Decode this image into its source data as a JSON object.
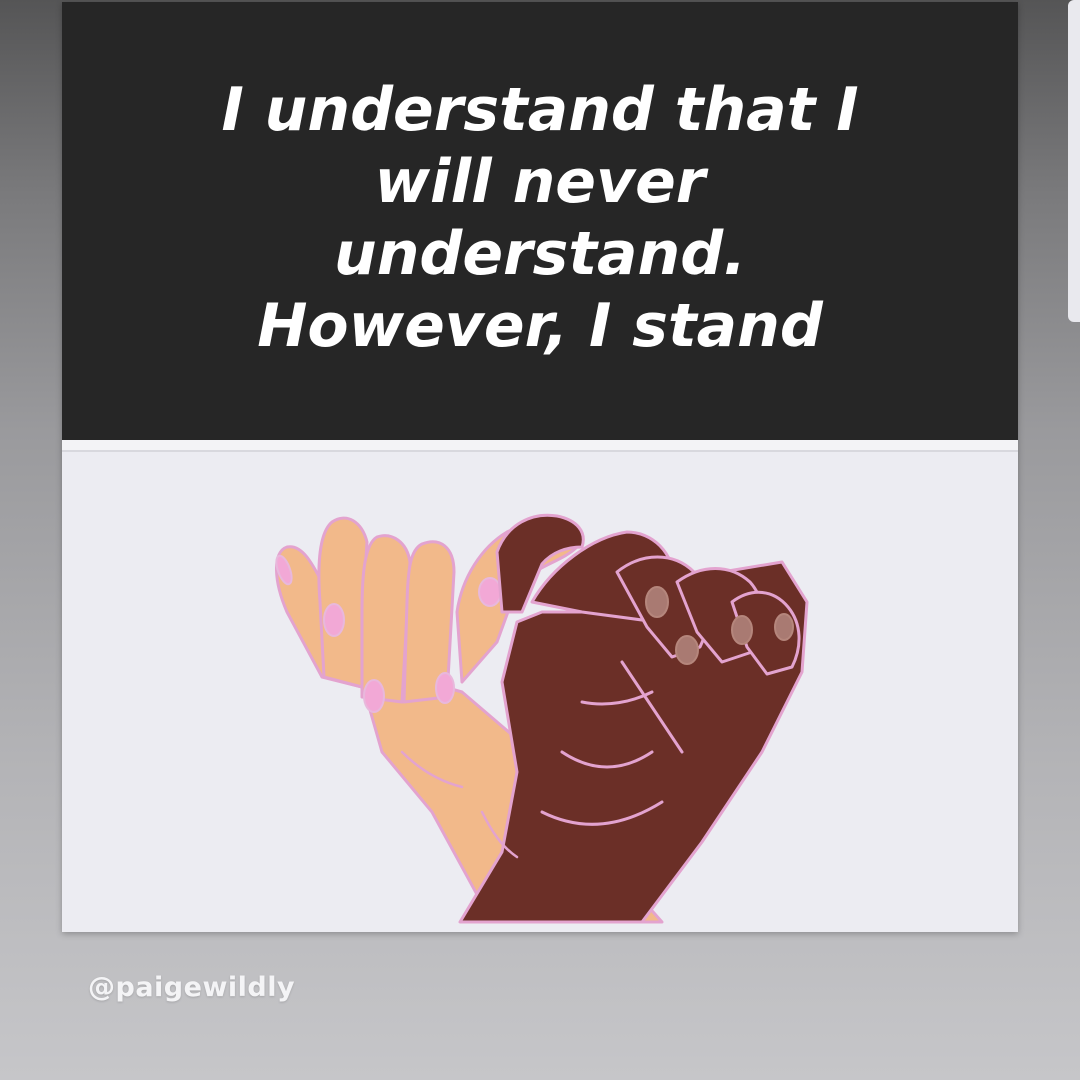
{
  "post": {
    "quote": "I understand that I\nwill never\nunderstand.\nHowever, I stand",
    "illustration_icon": "pinky-promise-hands-icon",
    "credit": "@paigewildly"
  },
  "colors": {
    "background_top": "#555556",
    "background_bottom": "#c6c6c9",
    "quote_band": "#262626",
    "quote_text": "#ffffff",
    "illustration_bg": "#ececf2",
    "light_skin": "#f2b98a",
    "dark_skin": "#6b2f27",
    "nail": "#f2a8d6",
    "outline": "#e3a3cf"
  }
}
